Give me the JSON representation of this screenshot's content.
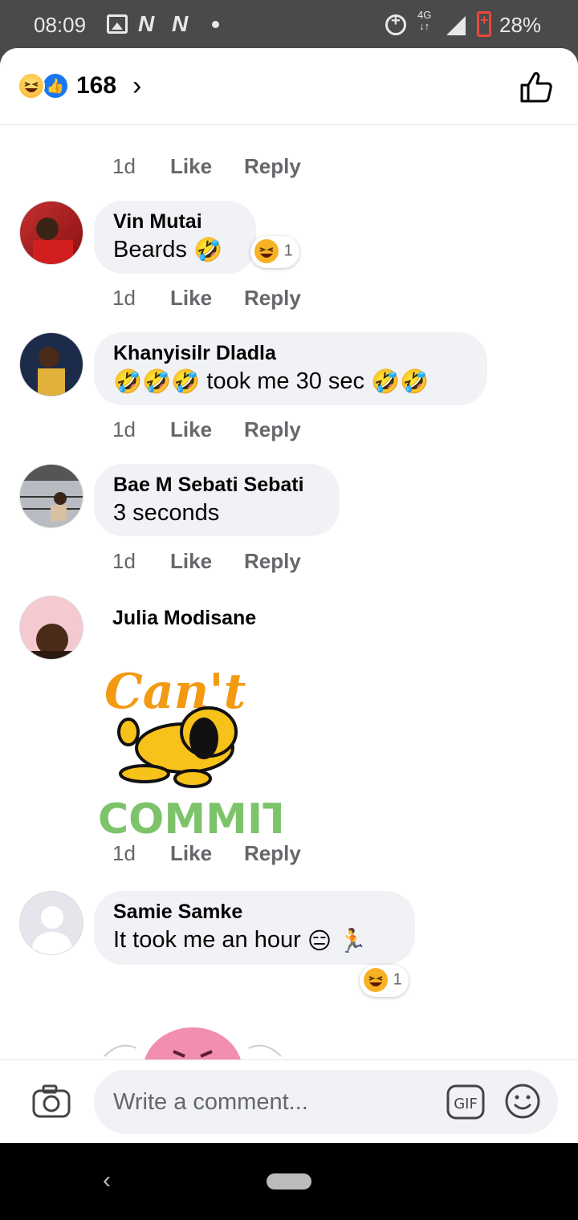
{
  "status_bar": {
    "time": "08:09",
    "n_icon": "N",
    "network_top": "4G",
    "battery_percent": "28%"
  },
  "header": {
    "reaction_count": "168",
    "reactions": [
      "haha-icon",
      "like-icon"
    ]
  },
  "comments": [
    {
      "meta": {
        "time": "1d",
        "like": "Like",
        "reply": "Reply"
      }
    },
    {
      "author": "Vin Mutai",
      "text": "Beards",
      "reaction_count": "1",
      "meta": {
        "time": "1d",
        "like": "Like",
        "reply": "Reply"
      }
    },
    {
      "author": "Khanyisilr Dladla",
      "text": "took me 30 sec",
      "meta": {
        "time": "1d",
        "like": "Like",
        "reply": "Reply"
      }
    },
    {
      "author": "Bae M Sebati Sebati",
      "text": "3 seconds",
      "meta": {
        "time": "1d",
        "like": "Like",
        "reply": "Reply"
      }
    },
    {
      "author": "Julia Modisane",
      "sticker": {
        "top": "Can't",
        "bottom": "COMMIT"
      },
      "meta": {
        "time": "1d",
        "like": "Like",
        "reply": "Reply"
      }
    },
    {
      "author": "Samie Samke",
      "text": "It took me an hour",
      "reaction_count": "1"
    }
  ],
  "input": {
    "placeholder": "Write a comment...",
    "gif_label": "GIF"
  },
  "colors": {
    "bubble": "#f0f2f5",
    "meta_text": "#65676b",
    "like_blue": "#1877f2",
    "haha_yellow": "#f7b125"
  }
}
